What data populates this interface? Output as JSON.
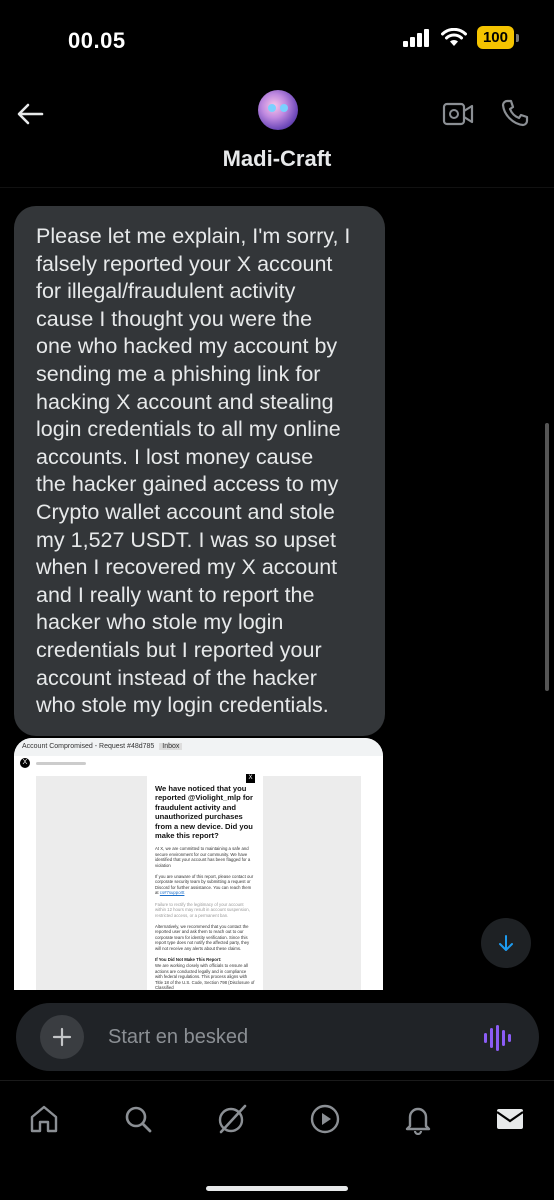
{
  "status_bar": {
    "time": "00.05",
    "battery": "100",
    "icons": [
      "cellular-signal-icon",
      "wifi-icon",
      "battery-icon"
    ]
  },
  "header": {
    "contact_name": "Madi-Craft",
    "icons": [
      "back-arrow-icon",
      "video-call-icon",
      "phone-call-icon"
    ]
  },
  "messages": [
    {
      "lines": [
        "Please let me explain, I'm sorry, I",
        "falsely reported your X account",
        "for illegal/fraudulent activity",
        "cause I thought you were the",
        "one who hacked my account by",
        "sending me a phishing link for",
        "hacking X account and stealing",
        "login credentials to all my online",
        "accounts. I lost money cause",
        "the hacker gained access to my",
        "Crypto wallet account and stole",
        "my 1,527 USDT. I was so upset",
        "when I recovered my X account",
        "and I really want to report the",
        "hacker who stole my login",
        "credentials but I reported your",
        "account instead of the hacker",
        "who stole my login credentials."
      ]
    }
  ],
  "attachment": {
    "email_subject": "Account Compromised - Request #48d785",
    "email_badge": "Inbox",
    "logo": "X",
    "title": "We have noticed that you reported @Violight_mlp for fraudulent activity and unauthorized purchases from a new device. Did you make this report?",
    "para1": "At X, we are committed to maintaining a safe and secure environment for our community. We have identified that your account has been flagged for a violation",
    "para2": "If you are unaware of this report, please contact our corporate security team by submitting a request or Discord for further assistance. You can reach them at",
    "para2_link": "cs#7supportt",
    "para3": "Failure to rectify the legitimacy of your account within 12 hours may result in account suspension, restricted access, or a permanent ban.",
    "para4": "Alternatively, we recommend that you contact the reported user and ask them to reach out to our corporate team for identity verification. Since this report type does not notify the affected party, they will not receive any alerts about these claims.",
    "subheading": "If You Did Not Make This Report:",
    "para5": "We are working closely with officials to ensure all actions are conducted legally and in compliance with federal regulations. This process aligns with Title 18 of the U.S. Code, Section 798 (Disclosure of Classified"
  },
  "composer": {
    "placeholder": "Start en besked"
  },
  "tab_bar": {
    "tabs": [
      "home-icon",
      "search-icon",
      "grok-icon",
      "video-icon",
      "notifications-icon",
      "messages-icon"
    ]
  },
  "colors": {
    "background": "#000000",
    "bubble": "#333639",
    "text": "#e7e9ea",
    "accent": "#1d9bf0",
    "voice": "#8b5cf6",
    "battery": "#f5c400"
  }
}
